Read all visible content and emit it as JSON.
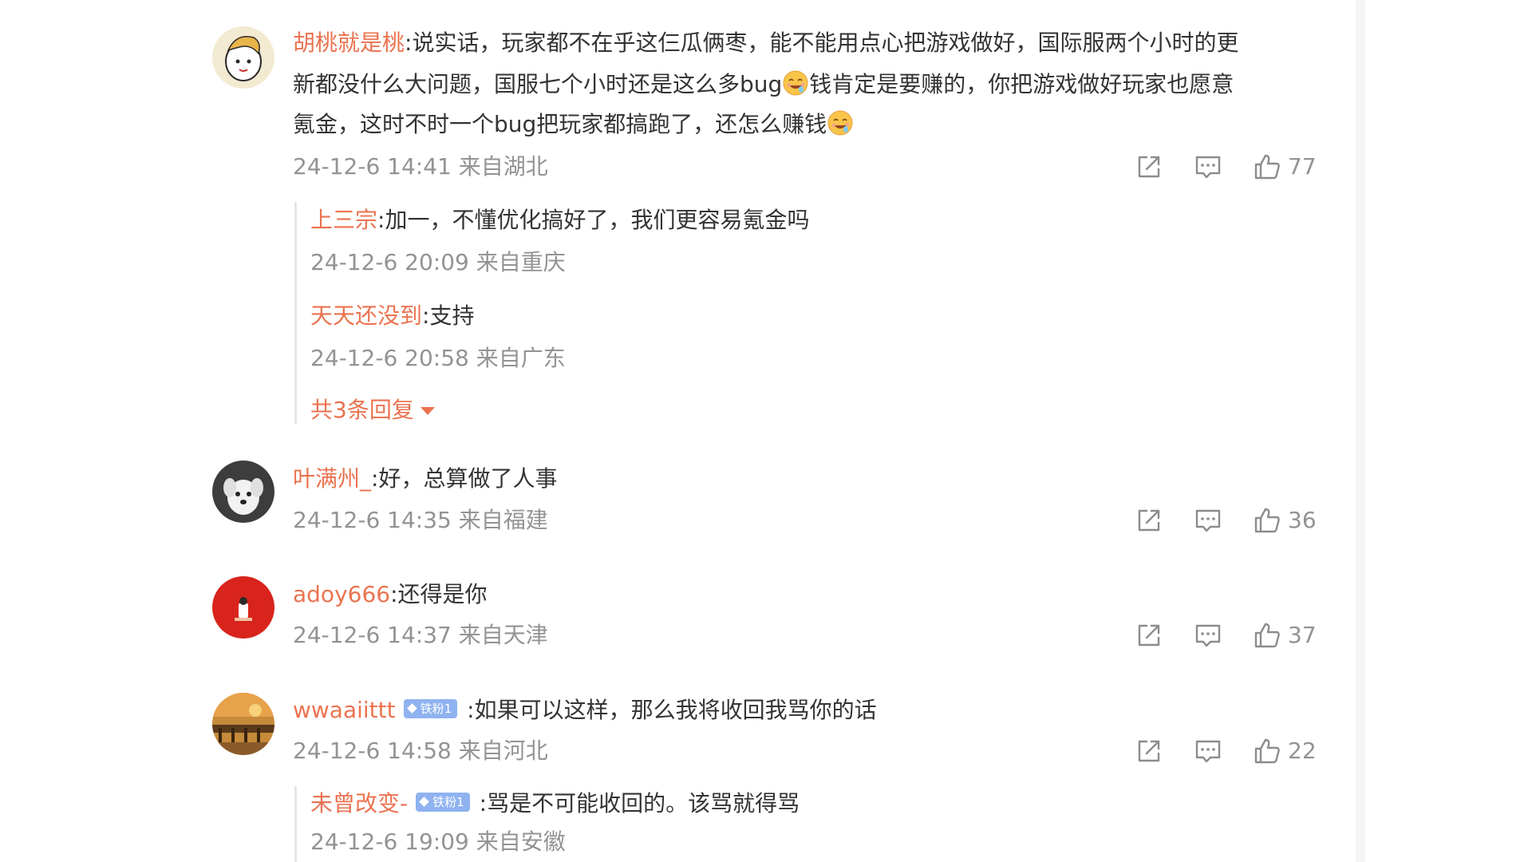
{
  "comments": [
    {
      "username": "胡桃就是桃",
      "text_line1": ":说实话，玩家都不在乎这仨瓜俩枣，能不能用点心把游戏做好，国际服两个小时的更",
      "text_line2_a": "新都没什么大问题，国服七个小时还是这么多bug",
      "text_line2_b": "钱肯定是要赚的，你把游戏做好玩家也愿意",
      "text_line3": "氪金，这时不时一个bug把玩家都搞跑了，还怎么赚钱",
      "timestamp": "24-12-6 14:41 来自湖北",
      "likes": "77",
      "emoji_name": "drooling-face-emoji",
      "replies": [
        {
          "username": "上三宗",
          "text": ":加一，不懂优化搞好了，我们更容易氪金吗",
          "timestamp": "24-12-6 20:09 来自重庆"
        },
        {
          "username": "天天还没到",
          "text": ":支持",
          "timestamp": "24-12-6 20:58 来自广东"
        }
      ],
      "more_replies_label": "共3条回复"
    },
    {
      "username": "叶满州_",
      "text": ":好，总算做了人事",
      "timestamp": "24-12-6 14:35 来自福建",
      "likes": "36"
    },
    {
      "username": "adoy666",
      "text": ":还得是你",
      "timestamp": "24-12-6 14:37 来自天津",
      "likes": "37"
    },
    {
      "username": "wwaaiittt",
      "badge": "铁粉1",
      "text": ":如果可以这样，那么我将收回我骂你的话",
      "timestamp": "24-12-6 14:58 来自河北",
      "likes": "22",
      "replies": [
        {
          "username": "未曾改变-",
          "badge": "铁粉1",
          "text": ":骂是不可能收回的。该骂就得骂",
          "timestamp": "24-12-6 19:09 来自安徽"
        }
      ]
    }
  ],
  "icons": {
    "share": "share-icon",
    "comment": "comment-icon",
    "like": "thumbs-up-icon"
  },
  "colors": {
    "username": "#eb7350",
    "meta": "#939393",
    "text": "#333333",
    "badge": "#8fb2f0"
  }
}
